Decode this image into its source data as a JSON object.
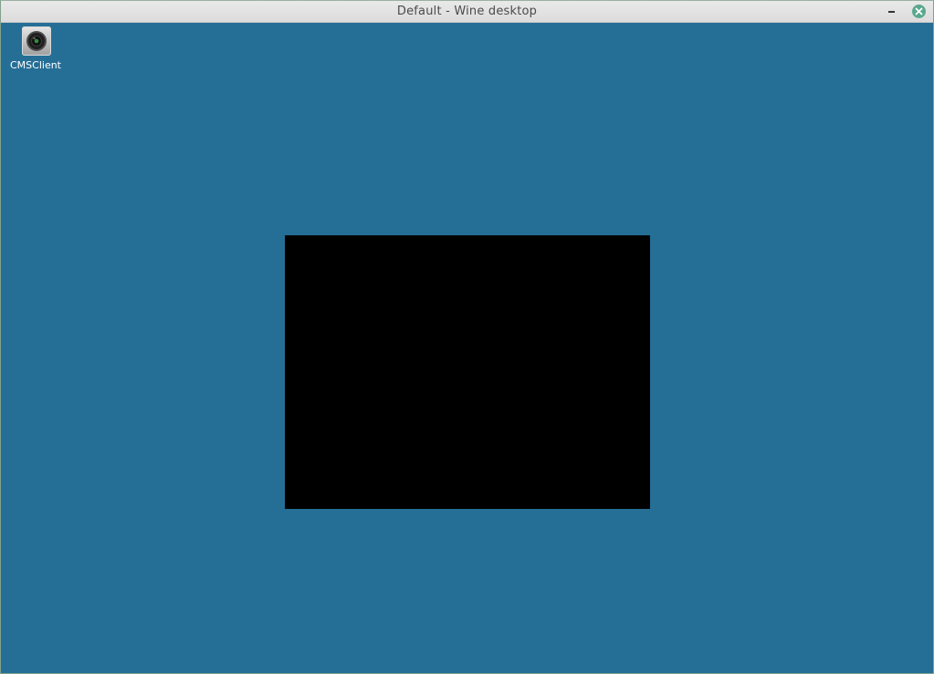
{
  "window": {
    "title": "Default - Wine desktop"
  },
  "desktop": {
    "icons": [
      {
        "label": "CMSClient",
        "icon": "camera-lens-icon"
      }
    ]
  },
  "colors": {
    "desktop_background": "#256f96",
    "titlebar": "#dcdcdc",
    "close_button": "#5aa88e",
    "app_window": "#000000"
  }
}
